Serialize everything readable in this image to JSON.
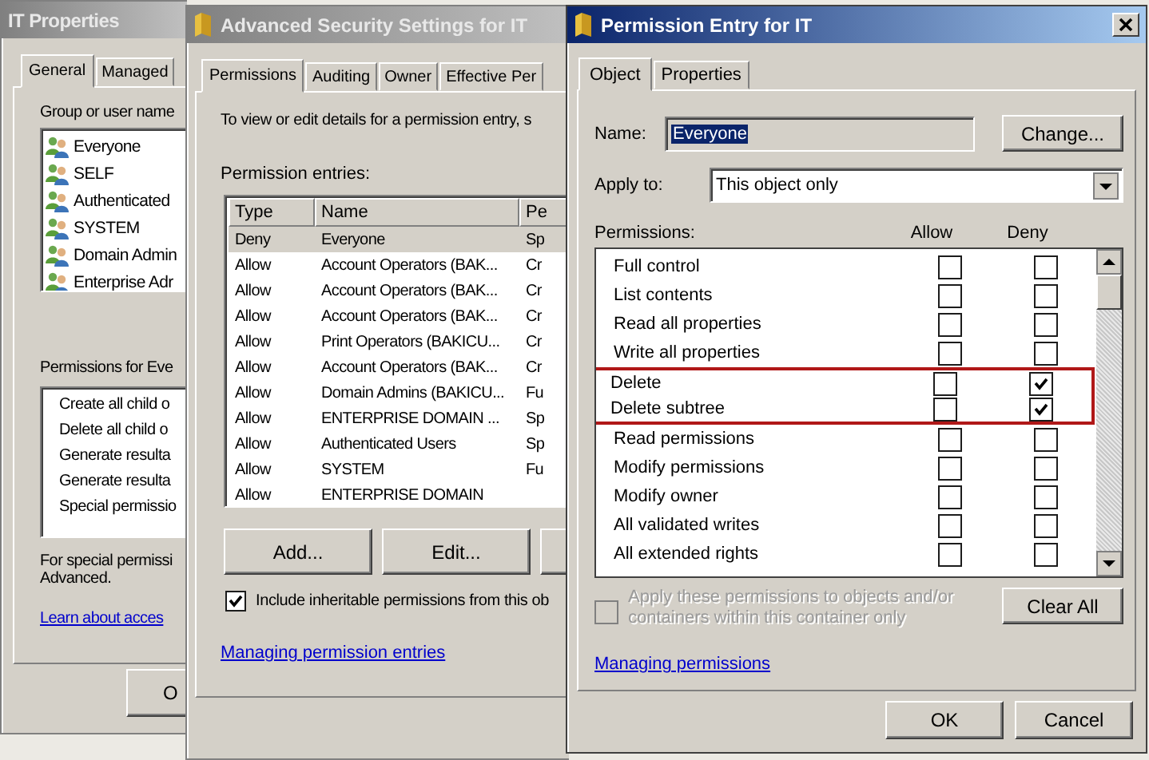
{
  "properties_window": {
    "title": "IT Properties",
    "active": false,
    "tabs": [
      {
        "label": "General",
        "selected": true
      },
      {
        "label": "Managed",
        "selected": false
      }
    ],
    "users_label": "Group or user name",
    "users": [
      "Everyone",
      "SELF",
      "Authenticated",
      "SYSTEM",
      "Domain Admin",
      "Enterprise Adr"
    ],
    "permissions_label": "Permissions for Eve",
    "permissions": [
      "Create all child o",
      "Delete all child o",
      "Generate resulta",
      "Generate resulta",
      "Special permissio"
    ],
    "note_lines": [
      "For special permissi",
      "Advanced."
    ],
    "link": "Learn about acces",
    "button": "O"
  },
  "advanced_window": {
    "title": "Advanced Security Settings for IT",
    "active": false,
    "tabs": [
      {
        "label": "Permissions",
        "selected": true
      },
      {
        "label": "Auditing",
        "selected": false
      },
      {
        "label": "Owner",
        "selected": false
      },
      {
        "label": "Effective Per",
        "selected": false
      }
    ],
    "intro": "To view or edit details for a permission entry, s",
    "entries_label": "Permission entries:",
    "columns": [
      "Type",
      "Name",
      "Pe"
    ],
    "rows": [
      {
        "cells": [
          "Deny",
          "Everyone",
          "Sp"
        ],
        "selected": true
      },
      {
        "cells": [
          "Allow",
          "Account Operators (BAK...",
          "Cr"
        ],
        "selected": false
      },
      {
        "cells": [
          "Allow",
          "Account Operators (BAK...",
          "Cr"
        ],
        "selected": false
      },
      {
        "cells": [
          "Allow",
          "Account Operators (BAK...",
          "Cr"
        ],
        "selected": false
      },
      {
        "cells": [
          "Allow",
          "Print Operators (BAKICU...",
          "Cr"
        ],
        "selected": false
      },
      {
        "cells": [
          "Allow",
          "Account Operators (BAK...",
          "Cr"
        ],
        "selected": false
      },
      {
        "cells": [
          "Allow",
          "Domain Admins (BAKICU...",
          "Fu"
        ],
        "selected": false
      },
      {
        "cells": [
          "Allow",
          "ENTERPRISE DOMAIN ...",
          "Sp"
        ],
        "selected": false
      },
      {
        "cells": [
          "Allow",
          "Authenticated Users",
          "Sp"
        ],
        "selected": false
      },
      {
        "cells": [
          "Allow",
          "SYSTEM",
          "Fu"
        ],
        "selected": false
      },
      {
        "cells": [
          "Allow",
          "ENTERPRISE DOMAIN"
        ],
        "selected": false
      }
    ],
    "buttons": [
      "Add...",
      "Edit..."
    ],
    "inherit": {
      "label": "Include inheritable permissions from this ob",
      "checked": true
    },
    "link": "Managing permission entries"
  },
  "entry_window": {
    "title": "Permission Entry for IT",
    "active": true,
    "tabs": [
      {
        "label": "Object",
        "selected": true
      },
      {
        "label": "Properties",
        "selected": false
      }
    ],
    "name_label": "Name:",
    "name_value": "Everyone",
    "name_value_selected": true,
    "change_button": "Change...",
    "apply_label": "Apply to:",
    "apply_value": "This object only",
    "permissions_label": "Permissions:",
    "columns": [
      "Allow",
      "Deny"
    ],
    "permissions": [
      {
        "label": "Full control",
        "allow": false,
        "deny": false,
        "highlighted": false
      },
      {
        "label": "List contents",
        "allow": false,
        "deny": false,
        "highlighted": false
      },
      {
        "label": "Read all properties",
        "allow": false,
        "deny": false,
        "highlighted": false
      },
      {
        "label": "Write all properties",
        "allow": false,
        "deny": false,
        "highlighted": false
      },
      {
        "label": "Delete",
        "allow": false,
        "deny": true,
        "highlighted": true
      },
      {
        "label": "Delete subtree",
        "allow": false,
        "deny": true,
        "highlighted": true
      },
      {
        "label": "Read permissions",
        "allow": false,
        "deny": false,
        "highlighted": false
      },
      {
        "label": "Modify permissions",
        "allow": false,
        "deny": false,
        "highlighted": false
      },
      {
        "label": "Modify owner",
        "allow": false,
        "deny": false,
        "highlighted": false
      },
      {
        "label": "All validated writes",
        "allow": false,
        "deny": false,
        "highlighted": false
      },
      {
        "label": "All extended rights",
        "allow": false,
        "deny": false,
        "highlighted": false
      }
    ],
    "apply_checkbox": {
      "label": "Apply these permissions to objects and/or containers within this container only",
      "checked": false,
      "disabled": true
    },
    "clear_button": "Clear All",
    "link": "Managing permissions",
    "buttons": [
      "OK",
      "Cancel"
    ]
  }
}
